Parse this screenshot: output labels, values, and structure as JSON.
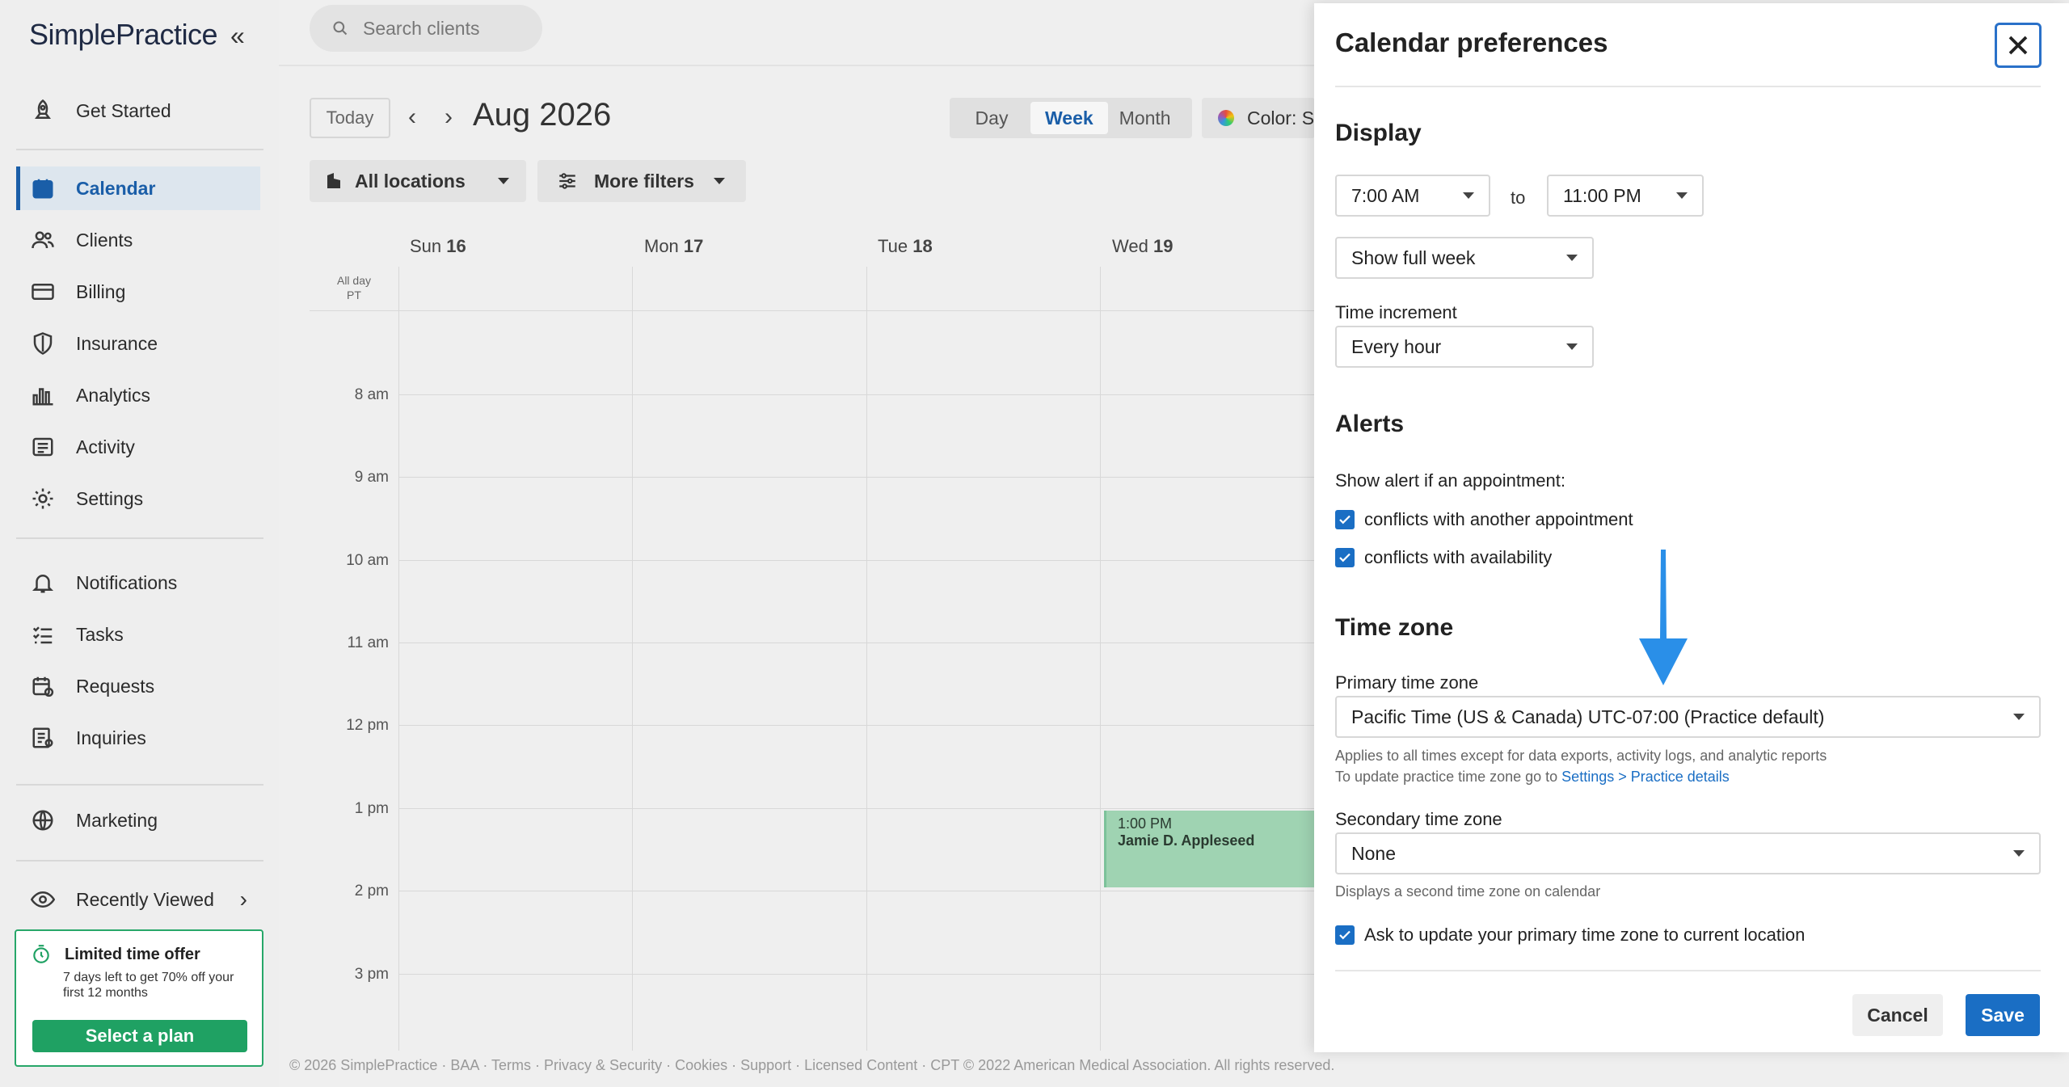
{
  "app": {
    "brand": "SimplePractice"
  },
  "sidebar": {
    "top_items": [
      {
        "label": "Get Started",
        "icon": "rocket-icon"
      }
    ],
    "main_items": [
      {
        "label": "Calendar",
        "icon": "calendar-icon",
        "active": true
      },
      {
        "label": "Clients",
        "icon": "users-icon"
      },
      {
        "label": "Billing",
        "icon": "credit-card-icon"
      },
      {
        "label": "Insurance",
        "icon": "shield-icon"
      },
      {
        "label": "Analytics",
        "icon": "bar-chart-icon"
      },
      {
        "label": "Activity",
        "icon": "list-icon"
      },
      {
        "label": "Settings",
        "icon": "gear-icon"
      }
    ],
    "secondary_items": [
      {
        "label": "Notifications",
        "icon": "bell-icon"
      },
      {
        "label": "Tasks",
        "icon": "checklist-icon"
      },
      {
        "label": "Requests",
        "icon": "calendar-request-icon"
      },
      {
        "label": "Inquiries",
        "icon": "inquiry-icon"
      }
    ],
    "marketing": {
      "label": "Marketing",
      "icon": "globe-icon"
    },
    "recently_viewed": {
      "label": "Recently Viewed",
      "icon": "eye-icon"
    },
    "offer": {
      "title": "Limited time offer",
      "text": "7 days left to get 70% off your first 12 months",
      "button": "Select a plan"
    }
  },
  "topbar": {
    "search_placeholder": "Search clients"
  },
  "toolbar": {
    "today": "Today",
    "month_title": "Aug 2026",
    "views": [
      "Day",
      "Week",
      "Month"
    ],
    "selected_view": "Week",
    "color_label": "Color: S",
    "locations": "All locations",
    "more_filters": "More filters"
  },
  "calendar": {
    "days": [
      {
        "name": "Sun",
        "num": "16"
      },
      {
        "name": "Mon",
        "num": "17"
      },
      {
        "name": "Tue",
        "num": "18"
      },
      {
        "name": "Wed",
        "num": "19"
      }
    ],
    "allday_label": "All day",
    "tz_label": "PT",
    "hours": [
      "8 am",
      "9 am",
      "10 am",
      "11 am",
      "12 pm",
      "1 pm",
      "2 pm",
      "3 pm"
    ],
    "appointment": {
      "time": "1:00 PM",
      "client": "Jamie D. Appleseed",
      "color": "#9fd3b2"
    }
  },
  "footer": "© 2026 SimplePractice · BAA · Terms · Privacy & Security · Cookies · Support · Licensed Content · CPT © 2022 American Medical Association. All rights reserved.",
  "panel": {
    "title": "Calendar preferences",
    "display": {
      "heading": "Display",
      "start_time": "7:00 AM",
      "to": "to",
      "end_time": "11:00 PM",
      "week_option": "Show full week",
      "increment_label": "Time increment",
      "increment_value": "Every hour"
    },
    "alerts": {
      "heading": "Alerts",
      "intro": "Show alert if an appointment:",
      "options": [
        {
          "label": "conflicts with another appointment",
          "checked": true
        },
        {
          "label": "conflicts with availability",
          "checked": true
        }
      ]
    },
    "timezone": {
      "heading": "Time zone",
      "primary_label": "Primary time zone",
      "primary_value": "Pacific Time (US & Canada) UTC-07:00 (Practice default)",
      "primary_help_1": "Applies to all times except for data exports, activity logs, and analytic reports",
      "primary_help_2": "To update practice time zone go to ",
      "primary_help_link": "Settings > Practice details",
      "secondary_label": "Secondary time zone",
      "secondary_value": "None",
      "secondary_help": "Displays a second time zone on calendar",
      "ask_update": {
        "label": "Ask to update your primary time zone to current location",
        "checked": true
      }
    },
    "buttons": {
      "cancel": "Cancel",
      "save": "Save"
    }
  },
  "colors": {
    "brand_blue": "#1a6ec4",
    "offer_green": "#1fa163",
    "annotation_arrow": "#2a8fe8"
  }
}
